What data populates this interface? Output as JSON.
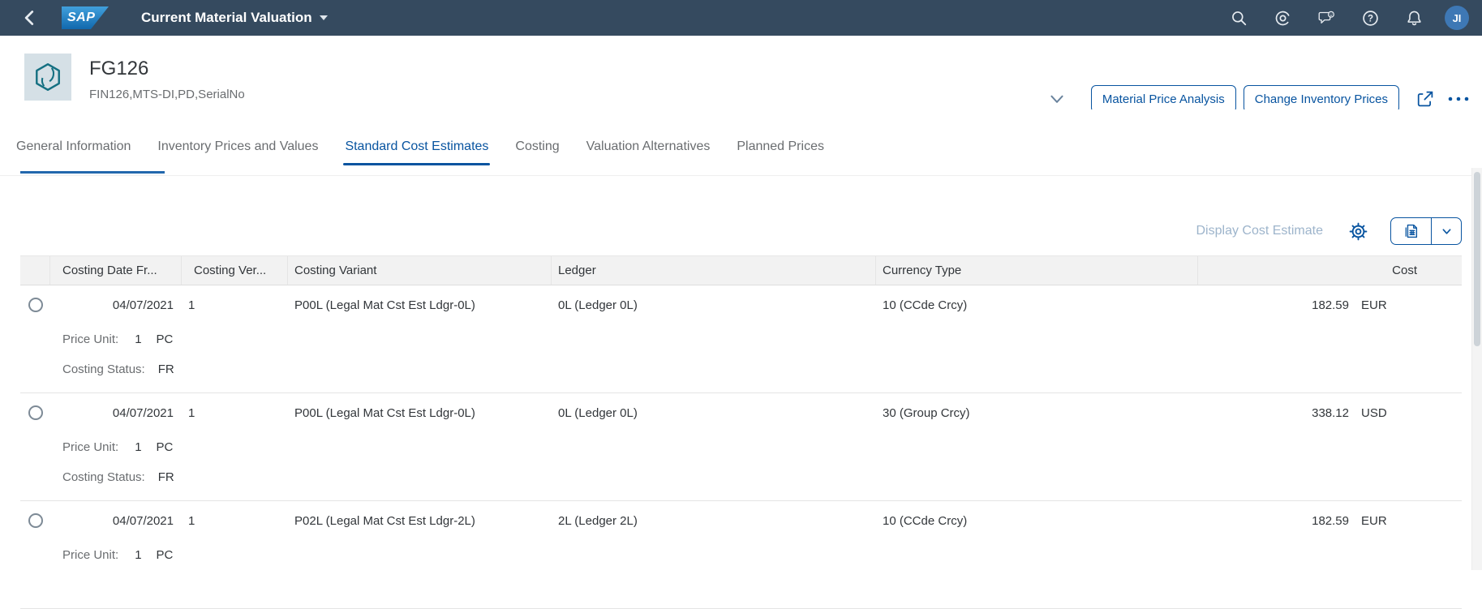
{
  "shell": {
    "logo_text": "SAP",
    "app_title": "Current Material Valuation",
    "help_glyph": "?",
    "avatar_initials": "JI"
  },
  "object_header": {
    "title": "FG126",
    "subtitle": "FIN126,MTS-DI,PD,SerialNo",
    "buttons": {
      "material_price_analysis": "Material Price Analysis",
      "change_inventory_prices": "Change Inventory Prices"
    }
  },
  "tabs": [
    {
      "label": "General Information"
    },
    {
      "label": "Inventory Prices and Values"
    },
    {
      "label": "Standard Cost Estimates"
    },
    {
      "label": "Costing"
    },
    {
      "label": "Valuation Alternatives"
    },
    {
      "label": "Planned Prices"
    }
  ],
  "selected_tab": "Standard Cost Estimates",
  "table_toolbar": {
    "display_cost_estimate_label": "Display Cost Estimate"
  },
  "table": {
    "headers": {
      "costing_date": "Costing Date Fr...",
      "costing_version": "Costing Ver...",
      "costing_variant": "Costing Variant",
      "ledger": "Ledger",
      "currency_type": "Currency Type",
      "cost": "Cost"
    },
    "rows": [
      {
        "costing_date": "04/07/2021",
        "costing_version": "1",
        "costing_variant": "P00L (Legal Mat Cst Est Ldgr-0L)",
        "ledger": "0L (Ledger 0L)",
        "currency_type": "10 (CCde Crcy)",
        "cost": "182.59",
        "currency": "EUR",
        "price_unit_label": "Price Unit:",
        "price_unit_value": "1",
        "price_unit_uom": "PC",
        "costing_status_label": "Costing Status:",
        "costing_status_value": "FR"
      },
      {
        "costing_date": "04/07/2021",
        "costing_version": "1",
        "costing_variant": "P00L (Legal Mat Cst Est Ldgr-0L)",
        "ledger": "0L (Ledger 0L)",
        "currency_type": "30 (Group Crcy)",
        "cost": "338.12",
        "currency": "USD",
        "price_unit_label": "Price Unit:",
        "price_unit_value": "1",
        "price_unit_uom": "PC",
        "costing_status_label": "Costing Status:",
        "costing_status_value": "FR"
      },
      {
        "costing_date": "04/07/2021",
        "costing_version": "1",
        "costing_variant": "P02L (Legal Mat Cst Est Ldgr-2L)",
        "ledger": "2L (Ledger 2L)",
        "currency_type": "10 (CCde Crcy)",
        "cost": "182.59",
        "currency": "EUR",
        "price_unit_label": "Price Unit:",
        "price_unit_value": "1",
        "price_unit_uom": "PC",
        "costing_status_label": "",
        "costing_status_value": ""
      }
    ]
  },
  "colors": {
    "shell_bar": "#354a5f",
    "accent_blue": "#0854a0",
    "table_header_bg": "#f2f2f2",
    "text_dark": "#32363a",
    "text_gray": "#6a6d70",
    "avatar_bg": "#3e78b5",
    "object_icon_bg": "#d5e0e6",
    "object_icon_teal": "#157082",
    "disabled_link": "#9db4cb"
  }
}
